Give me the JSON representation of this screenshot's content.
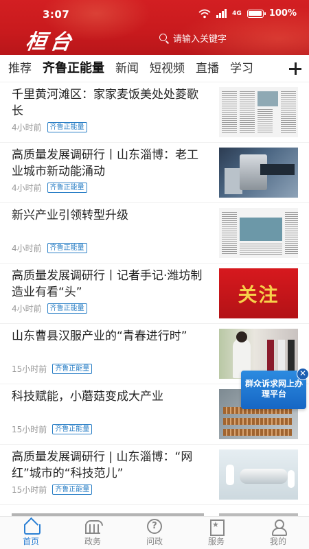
{
  "status": {
    "time": "3:07",
    "network": "4G",
    "battery": "100%"
  },
  "header": {
    "logo": "桓台",
    "search_placeholder": "请输入关键字"
  },
  "tabs": [
    "推荐",
    "齐鲁正能量",
    "新闻",
    "短视频",
    "直播",
    "学习"
  ],
  "active_tab": "齐鲁正能量",
  "feed": [
    {
      "title": "千里黄河滩区：家家麦饭美处处菱歌长",
      "time": "4小时前",
      "tag": "齐鲁正能量",
      "thumb": "newspaper"
    },
    {
      "title": "高质量发展调研行丨山东淄博：老工业城市新动能涌动",
      "time": "4小时前",
      "tag": "齐鲁正能量",
      "thumb": "machine"
    },
    {
      "title": "新兴产业引领转型升级",
      "time": "4小时前",
      "tag": "齐鲁正能量",
      "thumb": "newspaper"
    },
    {
      "title": "高质量发展调研行丨记者手记·潍坊制造业有看“头”",
      "time": "4小时前",
      "tag": "齐鲁正能量",
      "thumb": "focus",
      "thumb_text": "关注"
    },
    {
      "title": "山东曹县汉服产业的“青春进行时”",
      "time": "15小时前",
      "tag": "齐鲁正能量",
      "thumb": "person"
    },
    {
      "title": "科技赋能，小蘑菇变成大产业",
      "time": "15小时前",
      "tag": "齐鲁正能量",
      "thumb": "mushroom"
    },
    {
      "title": "高质量发展调研行 | 山东淄博：“网红”城市的“科技范儿”",
      "time": "15小时前",
      "tag": "齐鲁正能量",
      "thumb": "lab"
    }
  ],
  "promo": {
    "text": "群众诉求网上办理平台",
    "close": "✕"
  },
  "bottom_nav": [
    {
      "label": "首页",
      "icon": "home-icon",
      "active": true
    },
    {
      "label": "政务",
      "icon": "government-icon",
      "active": false
    },
    {
      "label": "问政",
      "icon": "question-icon",
      "active": false
    },
    {
      "label": "服务",
      "icon": "service-icon",
      "active": false
    },
    {
      "label": "我的",
      "icon": "profile-icon",
      "active": false
    }
  ],
  "colors": {
    "brand_red": "#d31f22",
    "accent_blue": "#2a7fd4",
    "tag_blue": "#2a7fc6"
  }
}
